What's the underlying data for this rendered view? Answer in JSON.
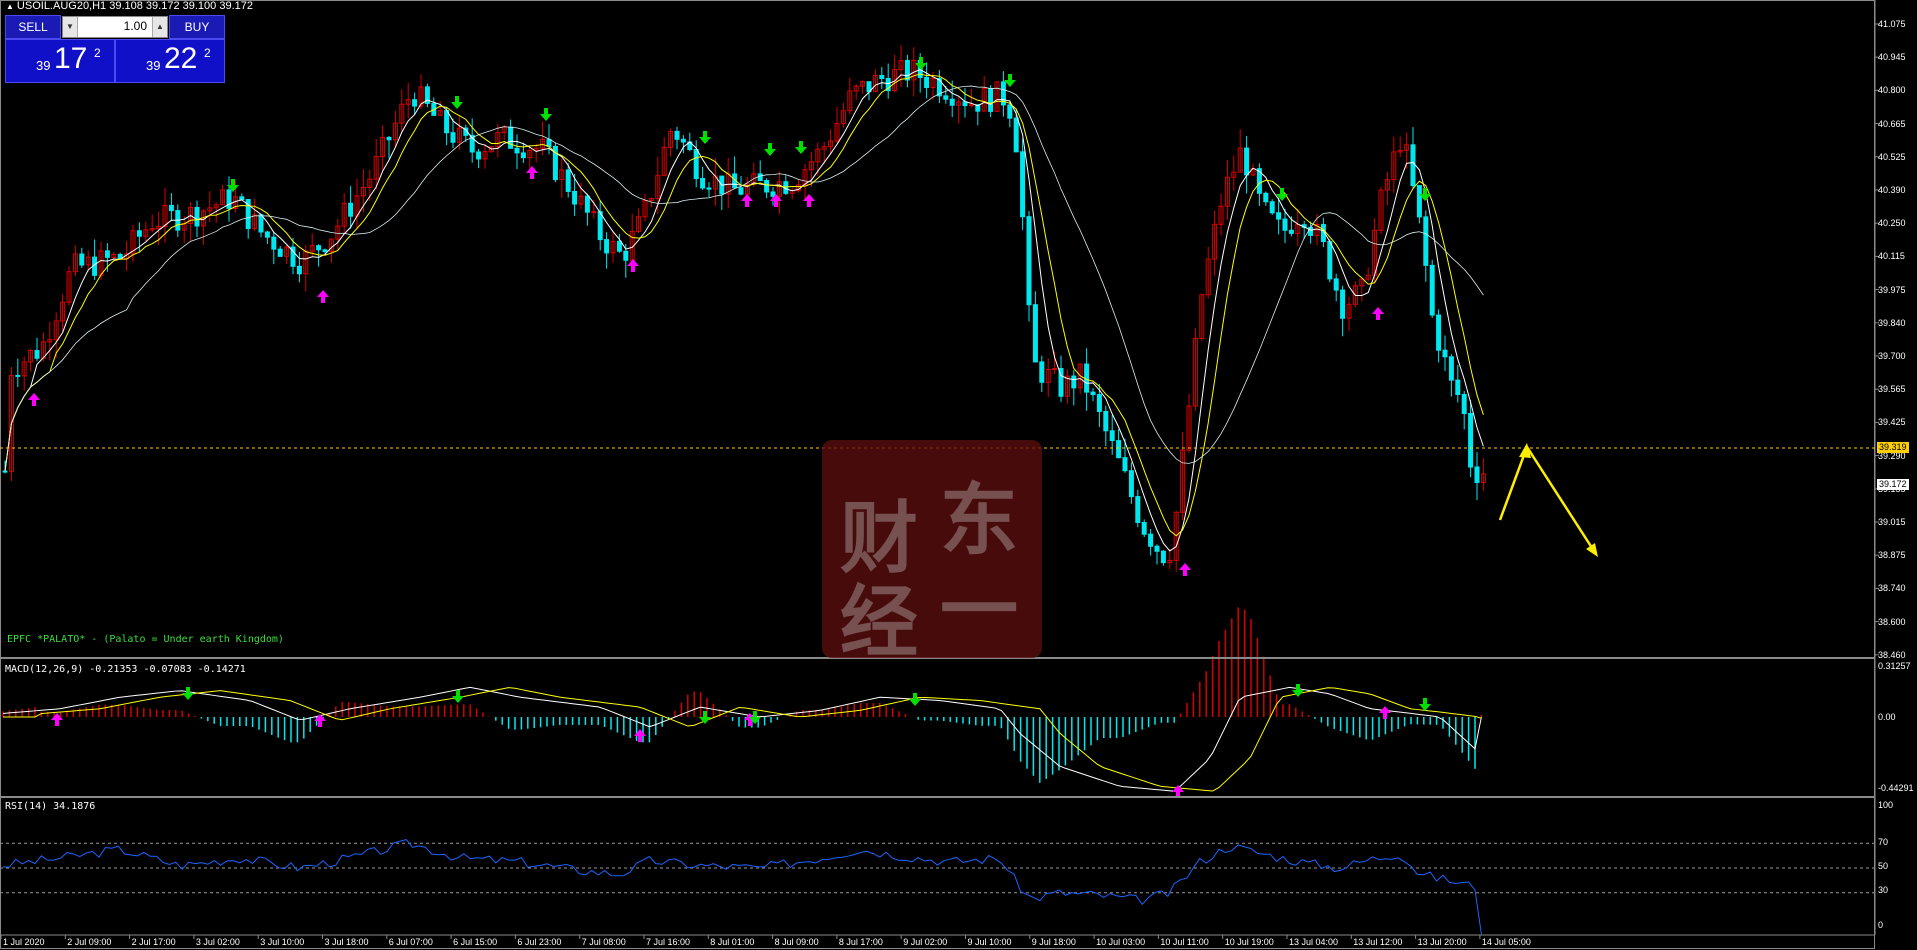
{
  "symbol_title": "USOIL.AUG20,H1  39.108 39.172 39.100 39.172",
  "trade_panel": {
    "sell_label": "SELL",
    "buy_label": "BUY",
    "lot_value": "1.00",
    "sell_price": {
      "prefix": "39",
      "big": "17",
      "sup": "2"
    },
    "buy_price": {
      "prefix": "39",
      "big": "22",
      "sup": "2"
    }
  },
  "indicator_note": "EPFC *PALATO* - (Palato = Under earth Kingdom)",
  "macd_label": "MACD(12,26,9) -0.21353 -0.07083 -0.14271",
  "rsi_label": "RSI(14) 34.1876",
  "watermark_chars": [
    "东",
    "财",
    "一",
    "经"
  ],
  "price_axis": [
    "41.075",
    "40.945",
    "40.800",
    "40.665",
    "40.525",
    "40.390",
    "40.250",
    "40.115",
    "39.975",
    "39.840",
    "39.700",
    "39.565",
    "39.425",
    "39.290",
    "39.155",
    "39.015",
    "38.875",
    "38.740",
    "38.600",
    "38.460"
  ],
  "price_tags": {
    "level": "39.319",
    "bid": "39.172"
  },
  "macd_axis": [
    "0.31257",
    "0.00",
    "-0.44291"
  ],
  "rsi_axis": [
    "100",
    "70",
    "50",
    "30",
    "0"
  ],
  "time_axis": [
    "1 Jul 2020",
    "2 Jul 09:00",
    "2 Jul 17:00",
    "3 Jul 02:00",
    "3 Jul 10:00",
    "3 Jul 18:00",
    "6 Jul 07:00",
    "6 Jul 15:00",
    "6 Jul 23:00",
    "7 Jul 08:00",
    "7 Jul 16:00",
    "8 Jul 01:00",
    "8 Jul 09:00",
    "8 Jul 17:00",
    "9 Jul 02:00",
    "9 Jul 10:00",
    "9 Jul 18:00",
    "10 Jul 03:00",
    "10 Jul 11:00",
    "10 Jul 19:00",
    "13 Jul 04:00",
    "13 Jul 12:00",
    "13 Jul 20:00",
    "14 Jul 05:00"
  ],
  "colors": {
    "bull": "#d80000",
    "bear": "#00e8ef",
    "ma_fast": "#ffffff",
    "ma_slow": "#ffff00",
    "level_line": "#ffd000",
    "buy_arrow": "#ff00ff",
    "sell_arrow": "#00e000",
    "rsi_line": "#1e64ff"
  }
}
